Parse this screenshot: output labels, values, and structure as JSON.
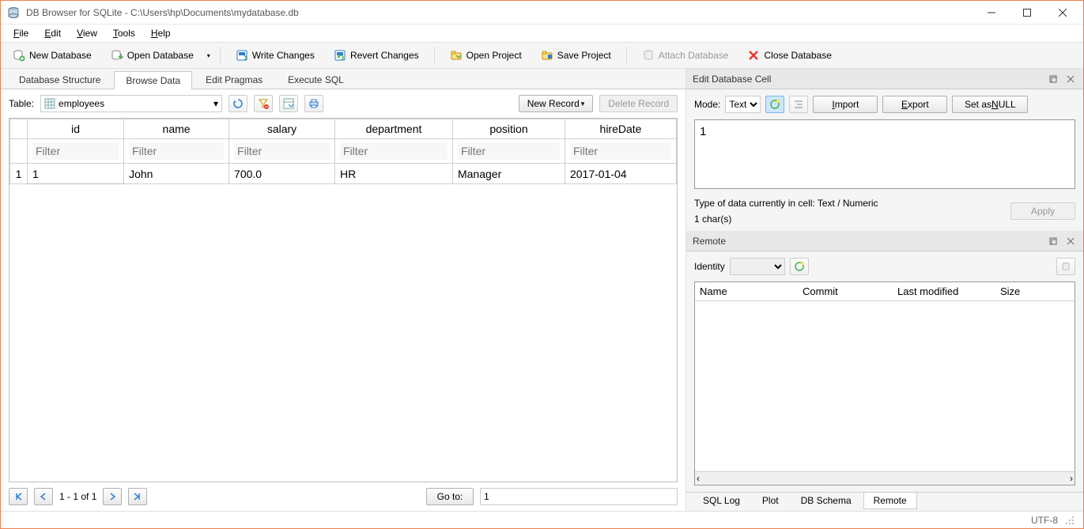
{
  "titlebar": {
    "title": "DB Browser for SQLite - C:\\Users\\hp\\Documents\\mydatabase.db"
  },
  "menu": {
    "file": "File",
    "edit": "Edit",
    "view": "View",
    "tools": "Tools",
    "help": "Help"
  },
  "toolbar": {
    "new_db": "New Database",
    "open_db": "Open Database",
    "write_changes": "Write Changes",
    "revert_changes": "Revert Changes",
    "open_project": "Open Project",
    "save_project": "Save Project",
    "attach_db": "Attach Database",
    "close_db": "Close Database"
  },
  "tabs": {
    "structure": "Database Structure",
    "browse": "Browse Data",
    "pragmas": "Edit Pragmas",
    "execute": "Execute SQL"
  },
  "table_controls": {
    "label": "Table:",
    "selected": "employees",
    "new_record": "New Record",
    "delete_record": "Delete Record"
  },
  "data_table": {
    "columns": [
      "id",
      "name",
      "salary",
      "department",
      "position",
      "hireDate"
    ],
    "filter_placeholder": "Filter",
    "rows": [
      {
        "idx": "1",
        "id": "1",
        "name": "John",
        "salary": "700.0",
        "department": "HR",
        "position": "Manager",
        "hireDate": "2017-01-04"
      }
    ]
  },
  "pager": {
    "range": "1 - 1 of 1",
    "goto_label": "Go to:",
    "goto_value": "1"
  },
  "edit_cell": {
    "title": "Edit Database Cell",
    "mode_label": "Mode:",
    "mode_value": "Text",
    "import": "Import",
    "export": "Export",
    "set_null": "Set as NULL",
    "value": "1",
    "type_line": "Type of data currently in cell: Text / Numeric",
    "chars": "1 char(s)",
    "apply": "Apply"
  },
  "remote": {
    "title": "Remote",
    "identity_label": "Identity",
    "columns": {
      "name": "Name",
      "commit": "Commit",
      "modified": "Last modified",
      "size": "Size"
    }
  },
  "bottom_tabs": {
    "sql_log": "SQL Log",
    "plot": "Plot",
    "db_schema": "DB Schema",
    "remote": "Remote"
  },
  "statusbar": {
    "encoding": "UTF-8"
  }
}
